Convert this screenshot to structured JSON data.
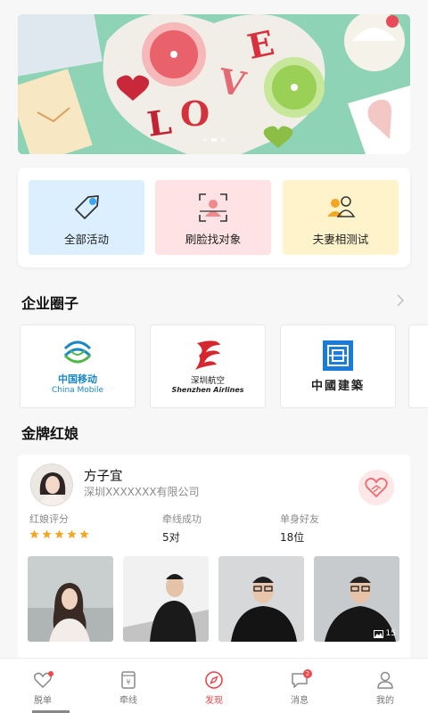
{
  "banner": {
    "text": "LOVE",
    "slides": 3,
    "active_slide": 1
  },
  "quick_actions": [
    {
      "label": "全部活动",
      "icon": "tag-icon"
    },
    {
      "label": "刷脸找对象",
      "icon": "face-scan-icon"
    },
    {
      "label": "夫妻相测试",
      "icon": "couple-icon"
    }
  ],
  "companies_section": {
    "title": "企业圈子"
  },
  "companies": [
    {
      "name": "中国移动",
      "sub": "China Mobile"
    },
    {
      "name": "深圳航空",
      "sub": "Shenzhen Airlines"
    },
    {
      "name": "中國建築"
    }
  ],
  "matchmaker_section": {
    "title": "金牌红娘"
  },
  "matchmaker": {
    "name": "方子宜",
    "company": "深圳XXXXXXX有限公司",
    "stats": [
      {
        "key": "红娘评分",
        "rating": 5
      },
      {
        "key": "牵线成功",
        "value": "5对"
      },
      {
        "key": "单身好友",
        "value": "18位"
      }
    ],
    "photo_count": "15"
  },
  "nav": [
    {
      "label": "脱单",
      "icon": "heart-icon"
    },
    {
      "label": "牵线",
      "icon": "cup-icon"
    },
    {
      "label": "发现",
      "icon": "compass-icon",
      "active": true
    },
    {
      "label": "消息",
      "icon": "message-icon",
      "badge": "2"
    },
    {
      "label": "我的",
      "icon": "user-icon"
    }
  ],
  "colors": {
    "accent": "#e8474b",
    "brand_blue": "#1a87c7"
  }
}
